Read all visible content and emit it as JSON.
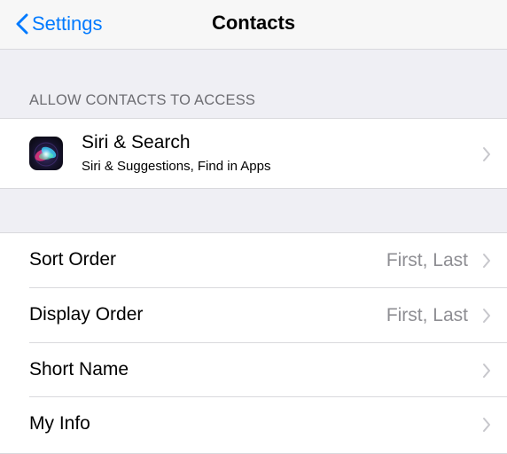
{
  "navbar": {
    "back_label": "Settings",
    "title": "Contacts",
    "accent_color": "#007aff"
  },
  "sections": {
    "allow_access_header": "ALLOW CONTACTS TO ACCESS"
  },
  "siri_item": {
    "title": "Siri & Search",
    "subtitle": "Siri & Suggestions, Find in Apps",
    "icon": "siri-icon"
  },
  "settings_rows": [
    {
      "label": "Sort Order",
      "value": "First, Last"
    },
    {
      "label": "Display Order",
      "value": "First, Last"
    },
    {
      "label": "Short Name",
      "value": ""
    },
    {
      "label": "My Info",
      "value": ""
    }
  ],
  "colors": {
    "background": "#efeff4",
    "secondary_text": "#8e8e93",
    "section_header_text": "#6d6d72"
  }
}
